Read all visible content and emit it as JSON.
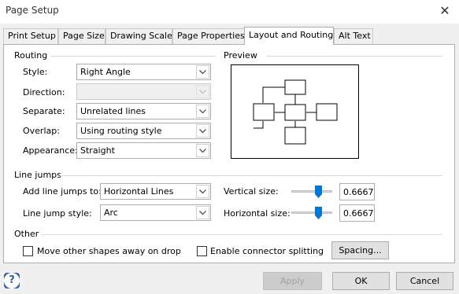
{
  "window": {
    "title": "Page Setup",
    "close_glyph": "✕"
  },
  "tabs": [
    {
      "label": "Print Setup"
    },
    {
      "label": "Page Size"
    },
    {
      "label": "Drawing Scale"
    },
    {
      "label": "Page Properties"
    },
    {
      "label": "Layout and Routing",
      "active": true
    },
    {
      "label": "Alt Text"
    }
  ],
  "routing": {
    "heading": "Routing",
    "style": {
      "label": "Style:",
      "value": "Right Angle"
    },
    "direction": {
      "label": "Direction:",
      "value": ""
    },
    "separate": {
      "label": "Separate:",
      "value": "Unrelated lines"
    },
    "overlap": {
      "label": "Overlap:",
      "value": "Using routing style"
    },
    "appearance": {
      "label": "Appearance:",
      "value": "Straight"
    }
  },
  "preview": {
    "heading": "Preview"
  },
  "line_jumps": {
    "heading": "Line jumps",
    "add": {
      "label": "Add line jumps to:",
      "value": "Horizontal Lines"
    },
    "style": {
      "label": "Line jump style:",
      "value": "Arc"
    },
    "vertical": {
      "label": "Vertical size:",
      "value": "0.6667",
      "level_percent": 66.67
    },
    "horizontal": {
      "label": "Horizontal size:",
      "value": "0.6667",
      "level_percent": 66.67
    }
  },
  "other": {
    "heading": "Other",
    "move_away": {
      "label": "Move other shapes away on drop",
      "checked": false
    },
    "connector_split": {
      "label": "Enable connector splitting",
      "checked": false
    },
    "spacing_label": "Spacing..."
  },
  "footer": {
    "help_glyph": "?",
    "apply_label": "Apply",
    "ok_label": "OK",
    "cancel_label": "Cancel"
  },
  "colors": {
    "accent": "#0078d7",
    "dialog_bg": "#f0f0f0",
    "panel_bg": "#ffffff"
  }
}
